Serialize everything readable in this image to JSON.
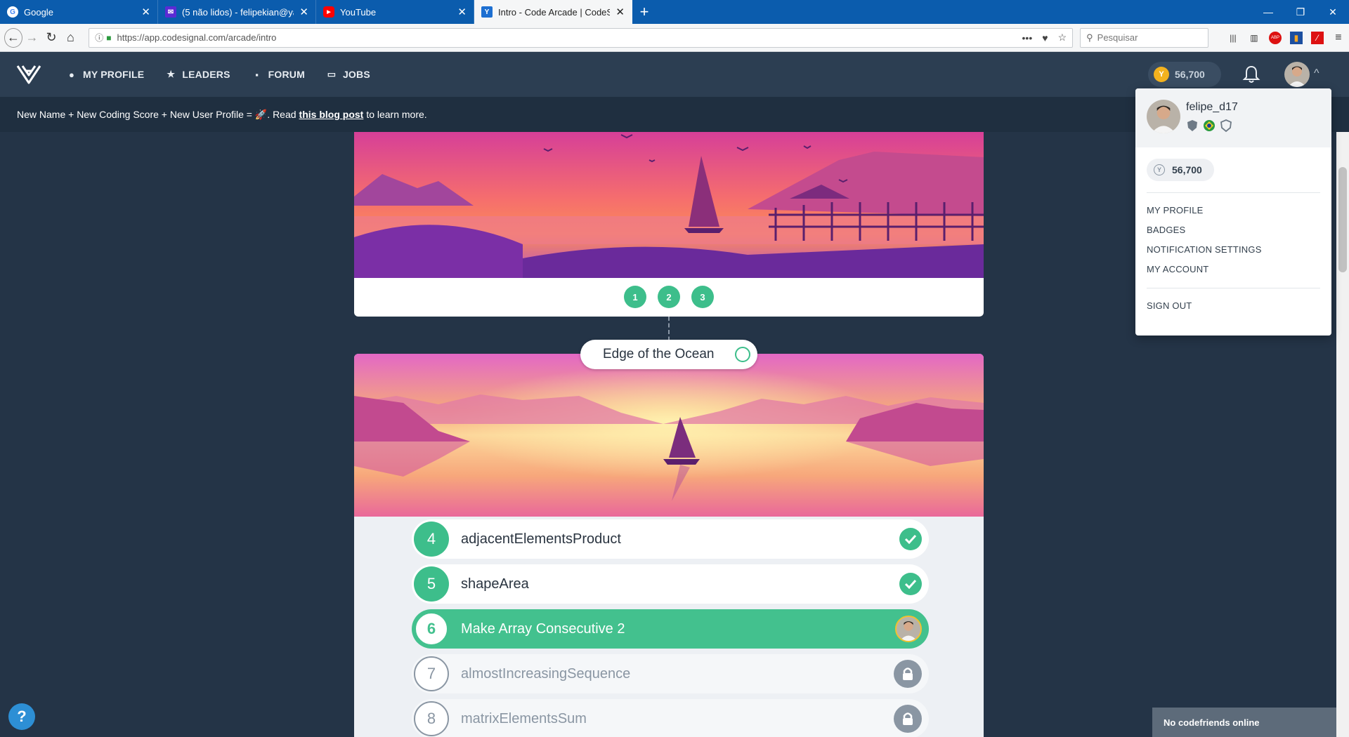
{
  "browser": {
    "tabs": [
      {
        "title": "Google",
        "icon": "google-icon",
        "color": "#ffffff"
      },
      {
        "title": "(5 não lidos) - felipekian@yahoo",
        "icon": "mail-icon",
        "color": "#5b2bd4"
      },
      {
        "title": "YouTube",
        "icon": "youtube-icon",
        "color": "#ff0000"
      },
      {
        "title": "Intro - Code Arcade | CodeSignal",
        "icon": "codesignal-icon",
        "color": "#1d6fd1"
      }
    ],
    "url": "https://app.codesignal.com/arcade/intro",
    "search_placeholder": "Pesquisar"
  },
  "app": {
    "nav": [
      {
        "label": "MY PROFILE",
        "icon": "user-circle-icon"
      },
      {
        "label": "LEADERS",
        "icon": "star-icon"
      },
      {
        "label": "FORUM",
        "icon": "chat-icon"
      },
      {
        "label": "JOBS",
        "icon": "briefcase-icon"
      }
    ],
    "coins": "56,700",
    "accent": "#3dbe8b"
  },
  "announcement": {
    "before": "New Name + New Coding Score + New User Profile = 🚀. Read",
    "link": "this blog post",
    "after": "to learn more."
  },
  "arcade": {
    "section1_pages": [
      "1",
      "2",
      "3"
    ],
    "level_title": "Edge of the Ocean",
    "tasks": [
      {
        "num": "4",
        "name": "adjacentElementsProduct",
        "status": "completed"
      },
      {
        "num": "5",
        "name": "shapeArea",
        "status": "completed"
      },
      {
        "num": "6",
        "name": "Make Array Consecutive 2",
        "status": "current"
      },
      {
        "num": "7",
        "name": "almostIncreasingSequence",
        "status": "locked"
      },
      {
        "num": "8",
        "name": "matrixElementsSum",
        "status": "locked"
      }
    ]
  },
  "dropdown": {
    "username": "felipe_d17",
    "coins": "56,700",
    "items": [
      "MY PROFILE",
      "BADGES",
      "NOTIFICATION SETTINGS",
      "MY ACCOUNT"
    ],
    "sign_out": "SIGN OUT"
  },
  "help": {
    "label": "?"
  },
  "codefriends": {
    "status": "No codefriends online"
  }
}
